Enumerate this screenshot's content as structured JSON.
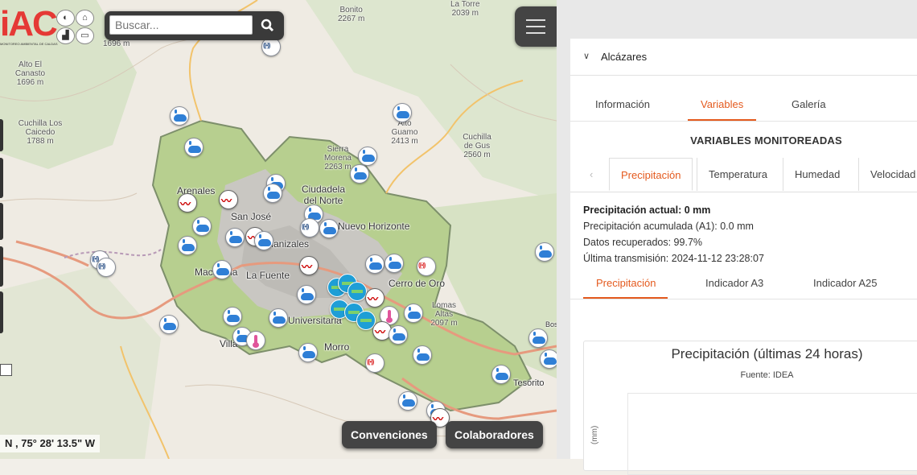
{
  "map": {
    "search": {
      "placeholder": "Buscar..."
    },
    "logo": {
      "letters": "AC",
      "prefix": "i",
      "subtitle": "MONITOREO AMBIENTAL DE CALDAS"
    },
    "coords": "N , 75° 28' 13.5\" W",
    "buttons": {
      "convenciones": "Convenciones",
      "colaboradores": "Colaboradores"
    },
    "places": [
      {
        "name": "Bonito",
        "elev": "2267 m"
      },
      {
        "name": "La Torre",
        "elev": "2039 m"
      },
      {
        "name": "Alto El Canasto",
        "elev": "1696 m"
      },
      {
        "name": "1696 m"
      },
      {
        "name": "Cuchilla Los Caicedo",
        "elev": "1788 m"
      },
      {
        "name": "Alto Guamo",
        "elev": "2413 m"
      },
      {
        "name": "Cuchilla de Gus",
        "elev": "2560 m"
      },
      {
        "name": "Sierra Morena",
        "elev": "2263 m"
      },
      {
        "name": "Lomas Altas",
        "elev": "2097 m"
      }
    ],
    "cities": [
      "Arenales",
      "San José",
      "Manizales",
      "La Fuente",
      "Macarena",
      "Ciudadela del Norte",
      "Nuevo Horizonte",
      "Cerro de Oro",
      "Universitaria",
      "Villa",
      "Morro",
      "Tesorito",
      "Bosques del Norte"
    ],
    "colors": {
      "rain": "#2f7fd6",
      "zone": "#7aa84f",
      "panel_bg": "#3a3a3a"
    }
  },
  "panel": {
    "accordion_title": "Alcázares",
    "tabs": [
      "Información",
      "Variables",
      "Galería"
    ],
    "active_tab": "Variables",
    "section_title": "VARIABLES MONITOREADAS",
    "var_tabs": [
      "Precipitación",
      "Temperatura",
      "Humedad",
      "Velocidad"
    ],
    "active_var": "Precipitación",
    "info": {
      "actual": "Precipitación actual: 0 mm",
      "acumulada": "Precipitación acumulada (A1): 0.0 mm",
      "datos": "Datos recuperados: 99.7%",
      "transmision": "Última transmisión: 2024-11-12 23:28:07"
    },
    "sub_tabs": [
      "Precipitación",
      "Indicador A3",
      "Indicador A25"
    ],
    "active_sub": "Precipitación",
    "chart": {
      "title": "Precipitación (últimas 24 horas)",
      "subtitle": "Fuente: IDEA",
      "ylabel": "(mm)"
    },
    "accent": "#e45a1e"
  }
}
